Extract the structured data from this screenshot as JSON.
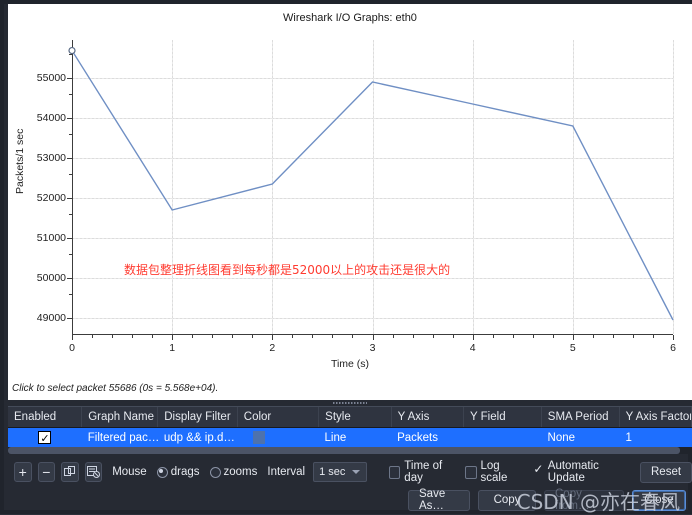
{
  "window": {
    "title": "Wireshark I/O Graphs: eth0"
  },
  "chart_data": {
    "type": "line",
    "title": "Wireshark I/O Graphs: eth0",
    "xlabel": "Time (s)",
    "ylabel": "Packets/1 sec",
    "xlim": [
      0,
      6
    ],
    "ylim": [
      48600,
      55950
    ],
    "xticks": [
      "0",
      "1",
      "2",
      "3",
      "4",
      "5",
      "6"
    ],
    "yticks": [
      "49000",
      "50000",
      "51000",
      "52000",
      "53000",
      "54000",
      "55000"
    ],
    "grid": true,
    "legend": "none",
    "series": [
      {
        "name": "Filtered packets",
        "color": "#6f8fc4",
        "x": [
          0,
          1,
          2,
          3,
          4,
          5,
          6
        ],
        "values": [
          55686,
          51700,
          52350,
          54900,
          54350,
          53800,
          48950
        ]
      }
    ],
    "annotations": [
      {
        "text": "数据包整理折线图看到每秒都是52000以上的攻击还是很大的",
        "color": "#ff3b30",
        "x": 0.9,
        "y": 50700
      }
    ]
  },
  "status": {
    "text": "Click to select packet 55686 (0s = 5.568e+04)."
  },
  "graph_table": {
    "headers": [
      "Enabled",
      "Graph Name",
      "Display Filter",
      "Color",
      "Style",
      "Y Axis",
      "Y Field",
      "SMA Period",
      "Y Axis Factor"
    ],
    "rows": [
      {
        "enabled": true,
        "graph_name": "Filtered pac…",
        "display_filter": "udp && ip.d…",
        "color": "#4e72ad",
        "style": "Line",
        "y_axis": "Packets",
        "y_field": "",
        "sma_period": "None",
        "y_axis_factor": "1"
      }
    ]
  },
  "toolbar": {
    "add_label": "+",
    "remove_label": "−",
    "copy_icon": "copy-icon",
    "clear_icon": "clear-icon",
    "mouse_label": "Mouse",
    "drags_label": "drags",
    "zooms_label": "zooms",
    "drags_selected": true,
    "interval_label": "Interval",
    "interval_value": "1 sec",
    "time_of_day_label": "Time of day",
    "time_of_day_checked": false,
    "log_scale_label": "Log scale",
    "log_scale_checked": false,
    "automatic_update_label": "Automatic Update",
    "automatic_update_checked": true,
    "reset_label": "Reset"
  },
  "footer": {
    "save_as_label": "Save As…",
    "copy_label": "Copy",
    "copy_from_label": "Copy from…",
    "close_label": "Close",
    "watermark": "CSDN @亦在春风"
  }
}
